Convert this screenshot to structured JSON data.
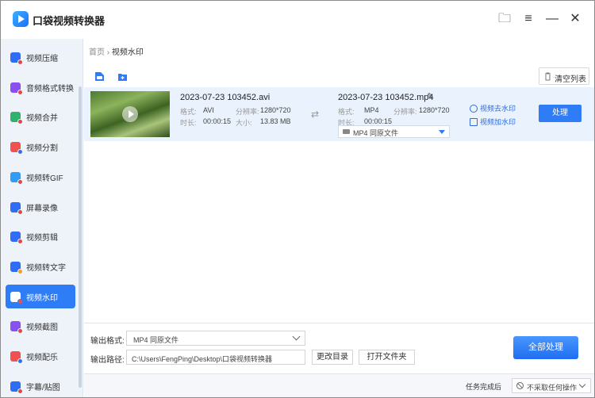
{
  "app": {
    "title": "口袋视频转换器"
  },
  "window_controls": {
    "folder": "🗀",
    "menu": "≡",
    "minimize": "—",
    "close": "✕"
  },
  "sidebar": {
    "items": [
      {
        "label": "视频压缩",
        "icon": "compress-icon",
        "color": "#2f6df6",
        "dot": "#e04848"
      },
      {
        "label": "音频格式转换",
        "icon": "audio-convert-icon",
        "color": "#8a4ff0",
        "dot": "#e04848"
      },
      {
        "label": "视频合并",
        "icon": "merge-icon",
        "color": "#2fb36a",
        "dot": "#e04848"
      },
      {
        "label": "视频分割",
        "icon": "split-icon",
        "color": "#f05050",
        "dot": "#2f6df6"
      },
      {
        "label": "视频转GIF",
        "icon": "gif-icon",
        "color": "#2f9df6",
        "dot": "#e04848"
      },
      {
        "label": "屏幕录像",
        "icon": "screen-record-icon",
        "color": "#2f6df6",
        "dot": "#e04848"
      },
      {
        "label": "视频剪辑",
        "icon": "edit-icon",
        "color": "#2f6df6",
        "dot": "#e04848"
      },
      {
        "label": "视频转文字",
        "icon": "video-to-text-icon",
        "color": "#2f6df6",
        "dot": "#f0a020"
      },
      {
        "label": "视频水印",
        "icon": "watermark-icon",
        "color": "#f05050",
        "dot": "#ffffff",
        "active": true
      },
      {
        "label": "视频截图",
        "icon": "screenshot-icon",
        "color": "#8a4ff0",
        "dot": "#e04848"
      },
      {
        "label": "视频配乐",
        "icon": "music-icon",
        "color": "#f05050",
        "dot": "#2f6df6"
      },
      {
        "label": "字幕/贴图",
        "icon": "subtitle-icon",
        "color": "#2f6df6",
        "dot": "#e04848"
      }
    ]
  },
  "breadcrumb": {
    "home": "首页",
    "separator": "›",
    "current": "视频水印"
  },
  "toolbar": {
    "clear_label": "清空列表"
  },
  "file": {
    "source": {
      "name": "2023-07-23 103452.avi",
      "format_label": "格式:",
      "format": "AVI",
      "resolution_label": "分辨率:",
      "resolution": "1280*720",
      "duration_label": "时长:",
      "duration": "00:00:15",
      "size_label": "大小:",
      "size": "13.83 MB"
    },
    "output": {
      "name": "2023-07-23 103452.mp4",
      "format_label": "格式:",
      "format": "MP4",
      "resolution_label": "分辨率:",
      "resolution": "1280*720",
      "duration_label": "时长:",
      "duration": "00:00:15",
      "select_value": "MP4   同原文件"
    },
    "actions": {
      "remove_watermark": "视频去水印",
      "add_watermark": "视频加水印",
      "process": "处理"
    }
  },
  "bottom": {
    "format_label": "输出格式:",
    "format_value": "MP4   同原文件",
    "path_label": "输出路径:",
    "path_value": "C:\\Users\\FengPing\\Desktop\\口袋视频转换器",
    "change_dir": "更改目录",
    "open_folder": "打开文件夹",
    "process_all": "全部处理"
  },
  "status": {
    "after_label": "任务完成后",
    "after_value": "不采取任何操作"
  },
  "colors": {
    "accent": "#2e7cf6",
    "sidebar_bg": "#eef3fa",
    "row_bg": "#eaf2fd"
  }
}
